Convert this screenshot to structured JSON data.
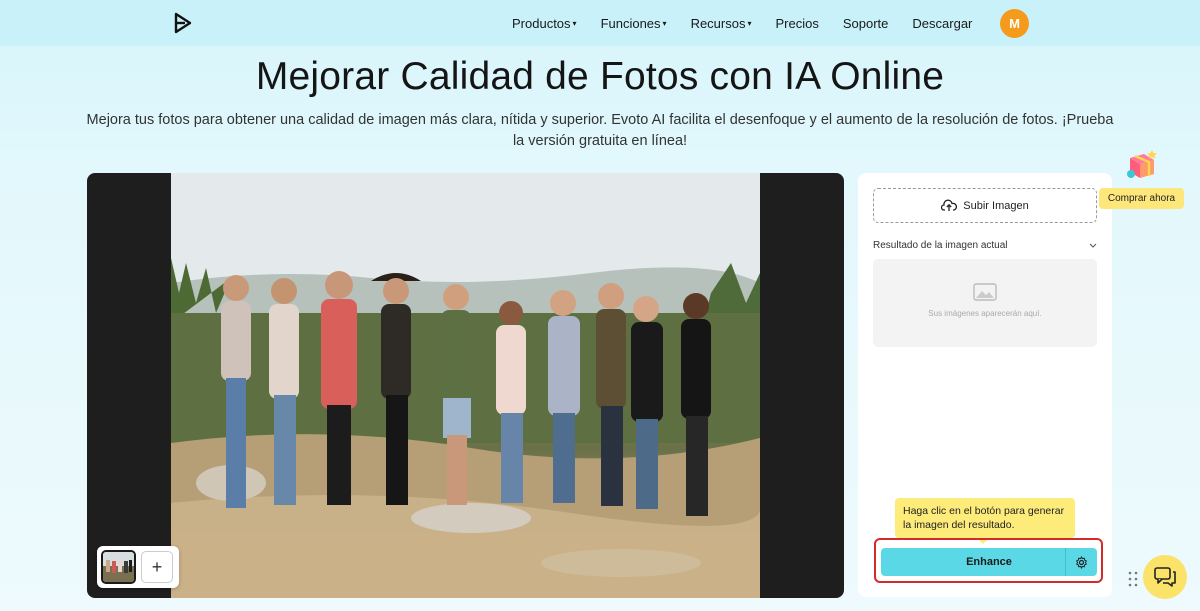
{
  "nav": {
    "items": [
      {
        "label": "Productos",
        "dropdown": true
      },
      {
        "label": "Funciones",
        "dropdown": true
      },
      {
        "label": "Recursos",
        "dropdown": true
      },
      {
        "label": "Precios",
        "dropdown": false
      },
      {
        "label": "Soporte",
        "dropdown": false
      },
      {
        "label": "Descargar",
        "dropdown": false
      }
    ],
    "avatar_initial": "M",
    "caret": "▾"
  },
  "hero": {
    "title": "Mejorar Calidad de Fotos con IA Online",
    "subtitle": "Mejora tus fotos para obtener una calidad de imagen más clara, nítida y superior. Evoto AI facilita el desenfoque y el aumento de la resolución de fotos. ¡Prueba la versión gratuita en línea!"
  },
  "editor": {
    "add_glyph": "+"
  },
  "side_panel": {
    "upload_label": "Subir Imagen",
    "result_label": "Resultado de la imagen actual",
    "empty_text": "Sus imágenes aparecerán aquí.",
    "tooltip": "Haga clic en el botón para generar la imagen del resultado.",
    "enhance_label": "Enhance"
  },
  "floating": {
    "buy_label": "Comprar ahora"
  },
  "colors": {
    "accent": "#5ad8e6",
    "avatar": "#f59a1b",
    "highlight_border": "#d32a2a",
    "tooltip": "#fdeb7a"
  }
}
